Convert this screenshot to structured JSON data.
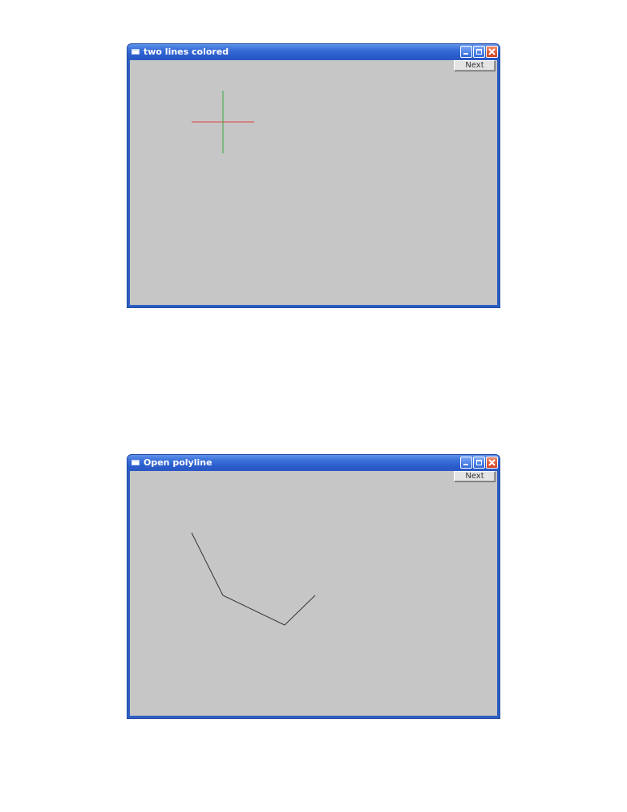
{
  "windows": [
    {
      "title": "two lines colored",
      "next_label": "Next",
      "drawing": {
        "lines": [
          {
            "color": "#e04040"
          },
          {
            "color": "#3aa63a"
          }
        ]
      }
    },
    {
      "title": "Open polyline",
      "next_label": "Next",
      "drawing": {
        "polyline_color": "#333333"
      }
    }
  ]
}
